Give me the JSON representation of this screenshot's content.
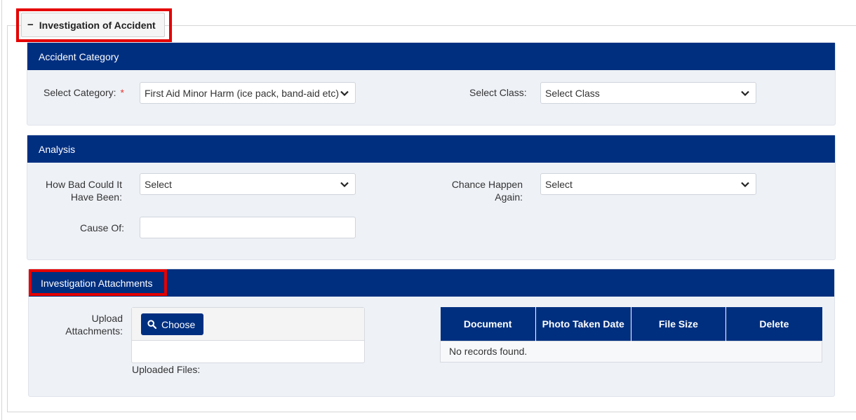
{
  "section": {
    "title": "Investigation of Accident",
    "collapse_symbol": "−"
  },
  "accident_category": {
    "header": "Accident Category",
    "category_label": "Select Category:",
    "required_mark": "*",
    "category_value": "First Aid Minor Harm (ice pack, band-aid etc)",
    "class_label": "Select Class:",
    "class_value": "Select Class"
  },
  "analysis": {
    "header": "Analysis",
    "how_bad_label_line1": "How Bad Could It",
    "how_bad_label_line2": "Have Been:",
    "how_bad_value": "Select",
    "chance_label_line1": "Chance Happen",
    "chance_label_line2": "Again:",
    "chance_value": "Select",
    "cause_label": "Cause Of:",
    "cause_value": ""
  },
  "attachments": {
    "header": "Investigation Attachments",
    "upload_label_line1": "Upload",
    "upload_label_line2": "Attachments:",
    "choose_label": "Choose",
    "uploaded_files_label": "Uploaded Files:",
    "table": {
      "columns": [
        "Document",
        "Photo Taken Date",
        "File Size",
        "Delete"
      ],
      "empty_message": "No records found."
    }
  },
  "colors": {
    "header_bg": "#002f80",
    "panel_bg": "#eef1f6",
    "highlight": "#e50000",
    "required": "#e53935"
  }
}
